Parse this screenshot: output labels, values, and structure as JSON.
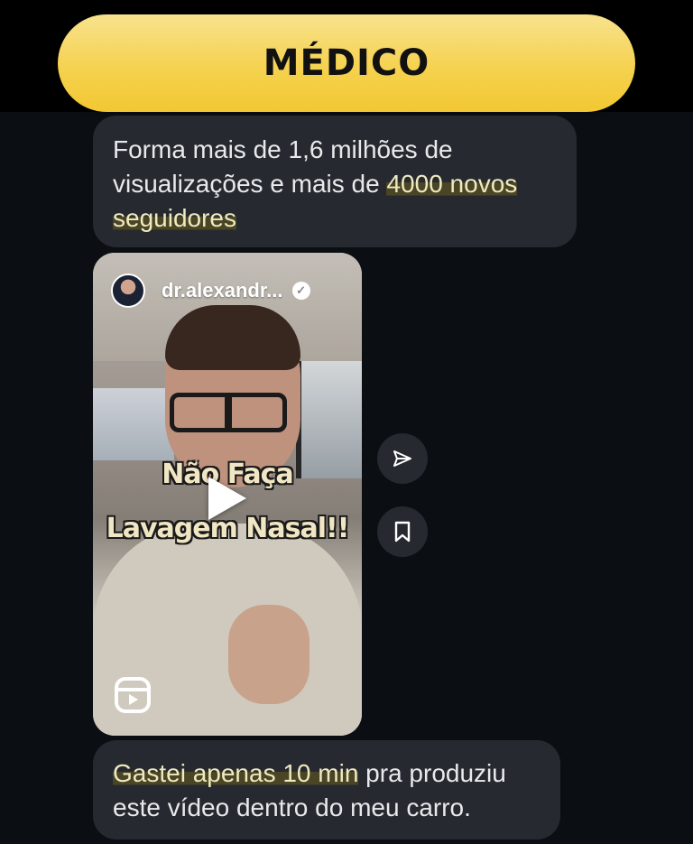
{
  "header": {
    "title": "MÉDICO"
  },
  "messages": {
    "first": {
      "text_part1": "Forma mais de 1,6 milhões de visualizações e mais de ",
      "highlight": "4000 novos seguidores"
    },
    "reel": {
      "username": "dr.alexandr...",
      "caption_line1": "Não Faça",
      "caption_line2": "Lavagem Nasal!!"
    },
    "second": {
      "highlight": "Gastei apenas 10 min",
      "text_part2": " pra produziu este vídeo dentro do meu carro."
    }
  },
  "actions": {
    "share_icon": "paper-plane-icon",
    "save_icon": "bookmark-icon"
  },
  "colors": {
    "accent": "#f5d24f",
    "bubble": "#262a30",
    "background": "#0b0e13",
    "highlight": "#4a4524"
  }
}
